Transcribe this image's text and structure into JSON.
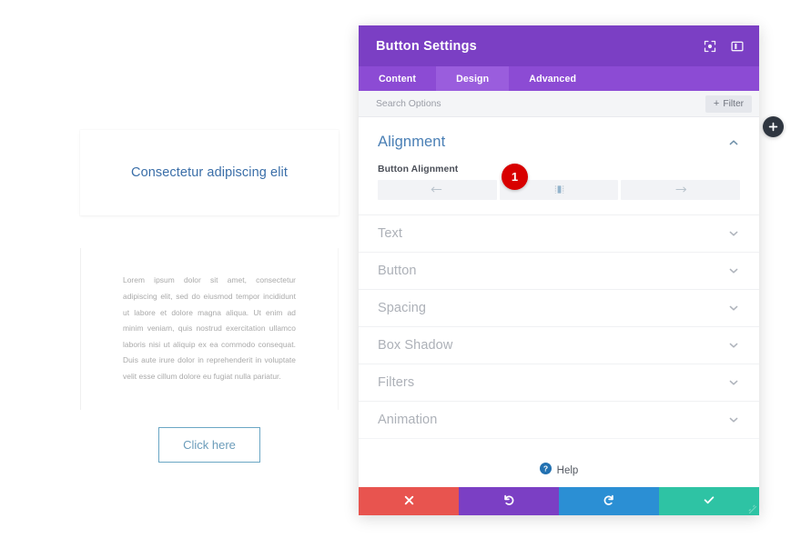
{
  "preview": {
    "heading": "Consectetur adipiscing elit",
    "paragraph": "Lorem ipsum dolor sit amet, consectetur adipiscing elit, sed do eiusmod tempor incididunt ut labore et dolore magna aliqua. Ut enim ad minim veniam, quis nostrud exercitation ullamco laboris nisi ut aliquip ex ea commodo consequat. Duis aute irure dolor in reprehenderit in voluptate velit esse cillum dolore eu fugiat nulla pariatur.",
    "button_label": "Click here",
    "heading_color": "#3a6ea8",
    "button_border_color": "#6aa6c4"
  },
  "panel": {
    "title": "Button Settings",
    "header_color": "#7b3fc4",
    "header_icons": [
      {
        "name": "fullscreen-icon",
        "label": "Fullscreen"
      },
      {
        "name": "layout-toggle-icon",
        "label": "Layout"
      }
    ],
    "tabs": [
      {
        "label": "Content",
        "active": false
      },
      {
        "label": "Design",
        "active": true
      },
      {
        "label": "Advanced",
        "active": false
      }
    ],
    "search": {
      "placeholder": "Search Options",
      "value": ""
    },
    "filter": {
      "label": "Filter",
      "plus": "+"
    },
    "alignment_section": {
      "title": "Alignment",
      "expanded": true,
      "field_label": "Button Alignment",
      "options": [
        {
          "value": "left",
          "icon": "align-left-icon",
          "selected": false
        },
        {
          "value": "center",
          "icon": "align-center-icon",
          "selected": false
        },
        {
          "value": "right",
          "icon": "align-right-icon",
          "selected": false
        }
      ]
    },
    "sections": [
      {
        "label": "Text",
        "expanded": false
      },
      {
        "label": "Button",
        "expanded": false
      },
      {
        "label": "Spacing",
        "expanded": false
      },
      {
        "label": "Box Shadow",
        "expanded": false
      },
      {
        "label": "Filters",
        "expanded": false
      },
      {
        "label": "Animation",
        "expanded": false
      }
    ],
    "help": {
      "label": "Help"
    },
    "footer_buttons": [
      {
        "name": "cancel",
        "icon": "close-icon",
        "color": "#e8544f"
      },
      {
        "name": "undo",
        "icon": "undo-icon",
        "color": "#7b3fc4"
      },
      {
        "name": "redo",
        "icon": "redo-icon",
        "color": "#2b8fd4"
      },
      {
        "name": "save",
        "icon": "check-icon",
        "color": "#2ec3a4"
      }
    ]
  },
  "overlay": {
    "step_badge": "1",
    "add_button_label": "+"
  }
}
